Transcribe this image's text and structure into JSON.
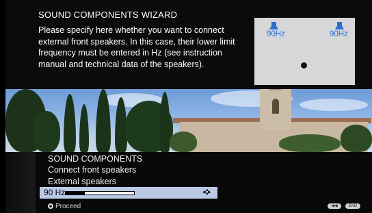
{
  "wizard": {
    "title": "SOUND COMPONENTS WIZARD",
    "description": "Please specify here whether you want to connect external front speakers. In this case, their lower limit frequency must be entered in Hz (see instruction manual and technical data of the speakers).",
    "preview": {
      "left_speaker_label": "90Hz",
      "right_speaker_label": "90Hz"
    }
  },
  "menu": {
    "heading": "SOUND COMPONENTS",
    "item_connect": "Connect front speakers",
    "item_external": "External speakers",
    "selected_value": "90 Hz",
    "slider_level_fraction": 0.28,
    "footer": {
      "proceed_label": "Proceed",
      "back_button": "◀◀",
      "end_button": "END"
    }
  },
  "colors": {
    "speaker_blue": "#2b6fcf",
    "selection_bg": "#b9c9e6"
  }
}
